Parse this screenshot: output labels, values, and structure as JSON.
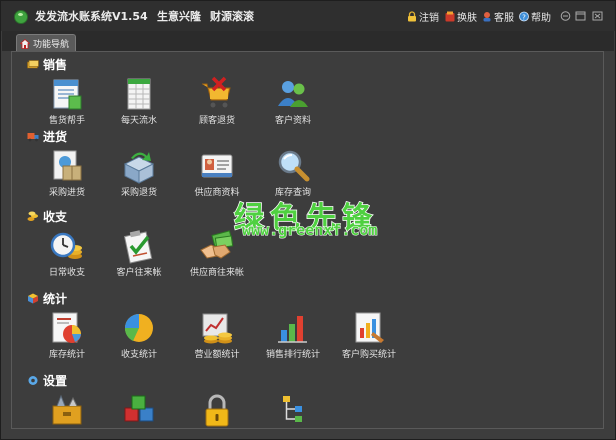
{
  "app": {
    "title": "发发流水账系统V1.54",
    "slogan_1": "生意兴隆",
    "slogan_2": "财源滚滚"
  },
  "toolbar": {
    "logout": "注销",
    "skin": "换肤",
    "service": "客服",
    "help": "帮助"
  },
  "tab": {
    "label": "功能导航"
  },
  "sections": {
    "sales": {
      "title": "销售",
      "items": [
        "售货帮手",
        "每天流水",
        "顾客退货",
        "客户资料"
      ]
    },
    "purchase": {
      "title": "进货",
      "items": [
        "采购进货",
        "采购退货",
        "供应商资料",
        "库存查询"
      ]
    },
    "finance": {
      "title": "收支",
      "items": [
        "日常收支",
        "客户往来帐",
        "供应商往来帐"
      ]
    },
    "stats": {
      "title": "统计",
      "items": [
        "库存统计",
        "收支统计",
        "营业额统计",
        "销售排行统计",
        "客户购买统计"
      ]
    },
    "settings": {
      "title": "设置",
      "items": [
        "",
        "",
        "",
        ""
      ]
    }
  },
  "watermark": {
    "text": "绿色先锋",
    "url": "www.greenxf.com"
  },
  "colors": {
    "background": "#3d3d3d",
    "titlebar": "#2f2f2f",
    "watermark_green": "#4fd040"
  }
}
